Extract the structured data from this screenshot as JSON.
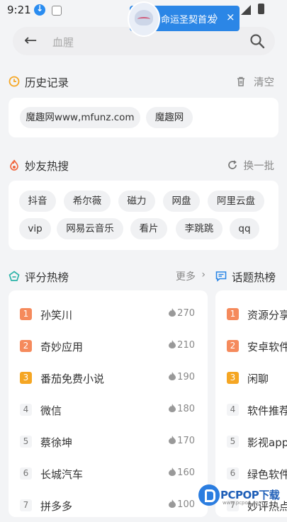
{
  "status": {
    "time": "9:21"
  },
  "notification": {
    "text": "命运圣契首发",
    "arrow": "〉",
    "close": "×"
  },
  "search": {
    "placeholder": "血腥"
  },
  "history": {
    "title": "历史记录",
    "action": "清空",
    "items": [
      "魔趣网www,mfunz.com",
      "魔趣网"
    ]
  },
  "hot_search": {
    "title": "妙友热搜",
    "action": "换一批",
    "rows": [
      [
        "抖音",
        "希尔薇",
        "磁力",
        "网盘",
        "阿里云盘"
      ],
      [
        "vip",
        "网易云音乐",
        "看片",
        "李跳跳",
        "qq"
      ]
    ]
  },
  "rating": {
    "title": "评分热榜",
    "more": "更多",
    "items": [
      {
        "rank": "1",
        "name": "孙笑川",
        "hot": "270"
      },
      {
        "rank": "2",
        "name": "奇妙应用",
        "hot": "210"
      },
      {
        "rank": "3",
        "name": "番茄免费小说",
        "hot": "190"
      },
      {
        "rank": "4",
        "name": "微信",
        "hot": "180"
      },
      {
        "rank": "5",
        "name": "蔡徐坤",
        "hot": "170"
      },
      {
        "rank": "6",
        "name": "长城汽车",
        "hot": "160"
      },
      {
        "rank": "7",
        "name": "拼多多",
        "hot": "100"
      }
    ]
  },
  "topics": {
    "title": "话题热榜",
    "items": [
      {
        "rank": "1",
        "name": "资源分享"
      },
      {
        "rank": "2",
        "name": "安卓软件"
      },
      {
        "rank": "3",
        "name": "闲聊"
      },
      {
        "rank": "4",
        "name": "软件推荐"
      },
      {
        "rank": "5",
        "name": "影视app"
      },
      {
        "rank": "6",
        "name": "绿色软件"
      },
      {
        "rank": "7",
        "name": "妙评热点"
      }
    ]
  },
  "watermark": {
    "text": "PCPOP下载",
    "sub": "www.pcpop.com"
  },
  "colors": {
    "rank1": "#f58a5c",
    "rank2": "#f58a5c",
    "rank3": "#f5a623",
    "accent": "#2b86e6"
  }
}
